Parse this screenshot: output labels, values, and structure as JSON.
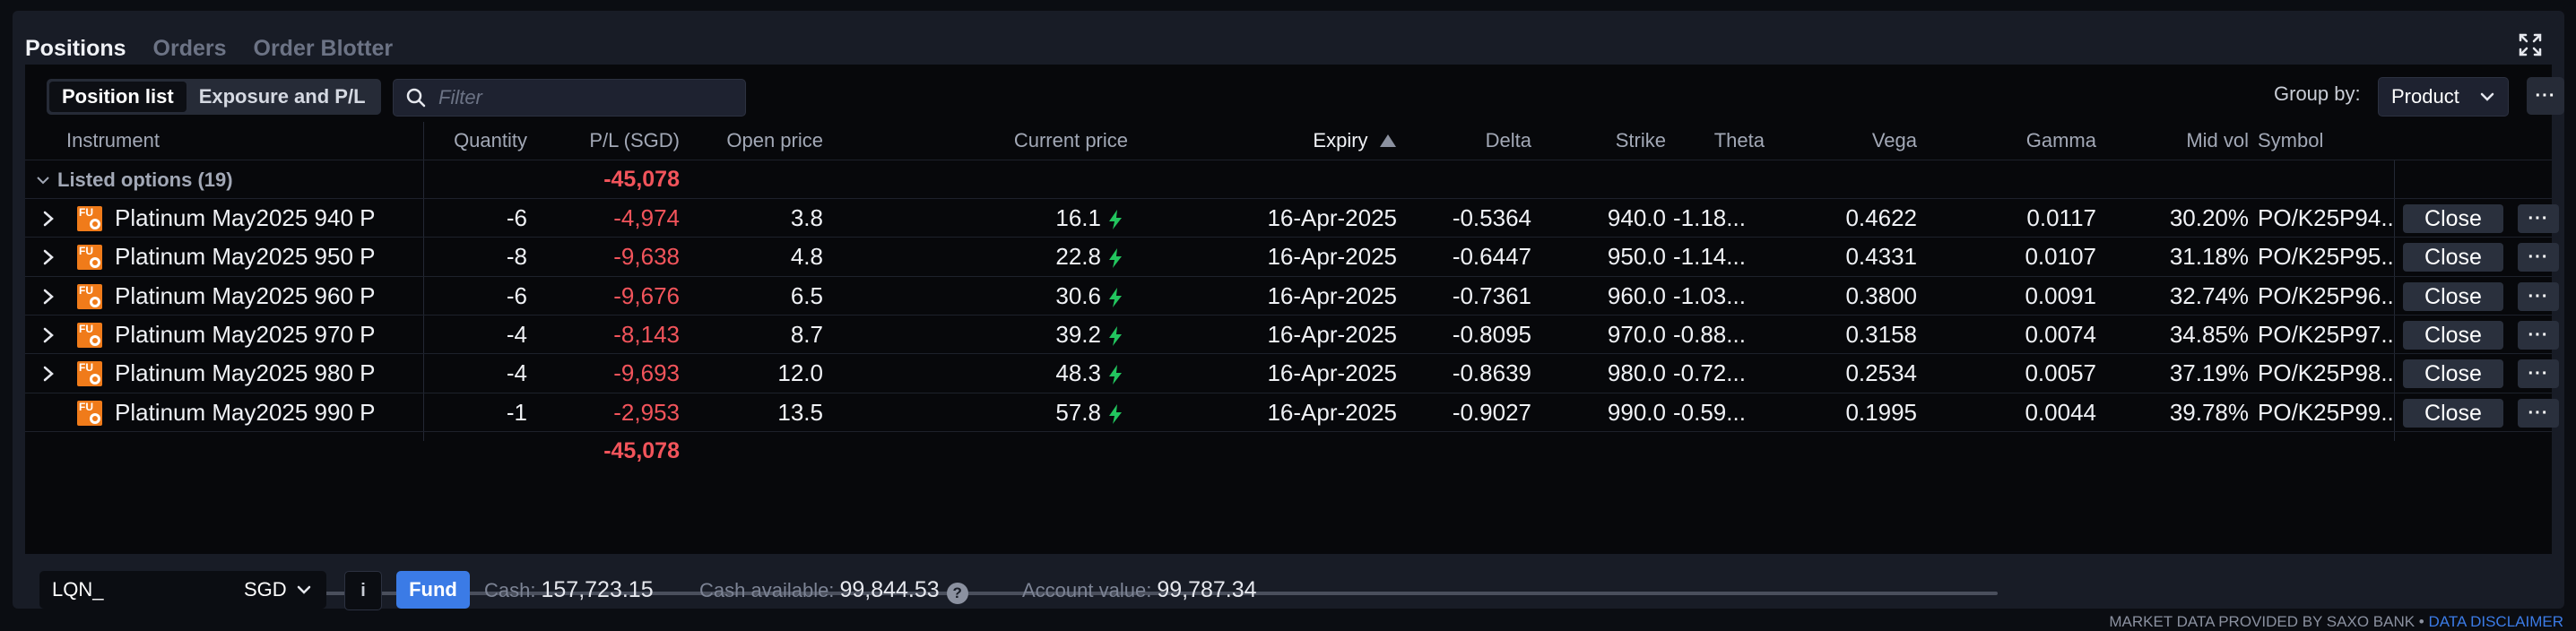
{
  "tabs": [
    "Positions",
    "Orders",
    "Order Blotter"
  ],
  "toolbar": {
    "view_options": [
      "Position list",
      "Exposure and P/L"
    ],
    "filter_placeholder": "Filter",
    "group_by_label": "Group by:",
    "group_by_value": "Product"
  },
  "columns": {
    "instrument": "Instrument",
    "quantity": "Quantity",
    "pl": "P/L (SGD)",
    "open_price": "Open price",
    "current_price": "Current price",
    "expiry": "Expiry",
    "delta": "Delta",
    "strike": "Strike",
    "theta": "Theta",
    "vega": "Vega",
    "gamma": "Gamma",
    "mid_vol": "Mid vol",
    "symbol": "Symbol"
  },
  "group": {
    "label": "Listed options (19)",
    "pl": "-45,078"
  },
  "rows": [
    {
      "instrument": "Platinum May2025 940 P",
      "quantity": "-6",
      "pl": "-4,974",
      "open_price": "3.8",
      "current_price": "16.1",
      "expiry": "16-Apr-2025",
      "delta": "-0.5364",
      "strike": "940.0",
      "theta": "-1.18...",
      "vega": "0.4622",
      "gamma": "0.0117",
      "mid_vol": "30.20%",
      "symbol": "PO/K25P94...",
      "close": "Close"
    },
    {
      "instrument": "Platinum May2025 950 P",
      "quantity": "-8",
      "pl": "-9,638",
      "open_price": "4.8",
      "current_price": "22.8",
      "expiry": "16-Apr-2025",
      "delta": "-0.6447",
      "strike": "950.0",
      "theta": "-1.14...",
      "vega": "0.4331",
      "gamma": "0.0107",
      "mid_vol": "31.18%",
      "symbol": "PO/K25P95...",
      "close": "Close"
    },
    {
      "instrument": "Platinum May2025 960 P",
      "quantity": "-6",
      "pl": "-9,676",
      "open_price": "6.5",
      "current_price": "30.6",
      "expiry": "16-Apr-2025",
      "delta": "-0.7361",
      "strike": "960.0",
      "theta": "-1.03...",
      "vega": "0.3800",
      "gamma": "0.0091",
      "mid_vol": "32.74%",
      "symbol": "PO/K25P96...",
      "close": "Close"
    },
    {
      "instrument": "Platinum May2025 970 P",
      "quantity": "-4",
      "pl": "-8,143",
      "open_price": "8.7",
      "current_price": "39.2",
      "expiry": "16-Apr-2025",
      "delta": "-0.8095",
      "strike": "970.0",
      "theta": "-0.88...",
      "vega": "0.3158",
      "gamma": "0.0074",
      "mid_vol": "34.85%",
      "symbol": "PO/K25P97...",
      "close": "Close"
    },
    {
      "instrument": "Platinum May2025 980 P",
      "quantity": "-4",
      "pl": "-9,693",
      "open_price": "12.0",
      "current_price": "48.3",
      "expiry": "16-Apr-2025",
      "delta": "-0.8639",
      "strike": "980.0",
      "theta": "-0.72...",
      "vega": "0.2534",
      "gamma": "0.0057",
      "mid_vol": "37.19%",
      "symbol": "PO/K25P98...",
      "close": "Close"
    },
    {
      "instrument": "Platinum May2025 990 P",
      "quantity": "-1",
      "pl": "-2,953",
      "open_price": "13.5",
      "current_price": "57.8",
      "expiry": "16-Apr-2025",
      "delta": "-0.9027",
      "strike": "990.0",
      "theta": "-0.59...",
      "vega": "0.1995",
      "gamma": "0.0044",
      "mid_vol": "39.78%",
      "symbol": "PO/K25P99...",
      "close": "Close"
    }
  ],
  "total_pl": "-45,078",
  "footer": {
    "account": "LQN_",
    "currency": "SGD",
    "info": "i",
    "fund": "Fund",
    "cash_label": "Cash:",
    "cash_value": "157,723.15",
    "cash_available_label": "Cash available:",
    "cash_available_value": "99,844.53",
    "account_value_label": "Account value:",
    "account_value_value": "99,787.34"
  },
  "disclaimer": {
    "text": "MARKET DATA PROVIDED BY SAXO BANK •",
    "link": "DATA DISCLAIMER"
  },
  "colors": {
    "negative": "#f2545b",
    "accent": "#3b7be6",
    "uptick": "#22c55e",
    "product_icon": "#f07b1a"
  }
}
